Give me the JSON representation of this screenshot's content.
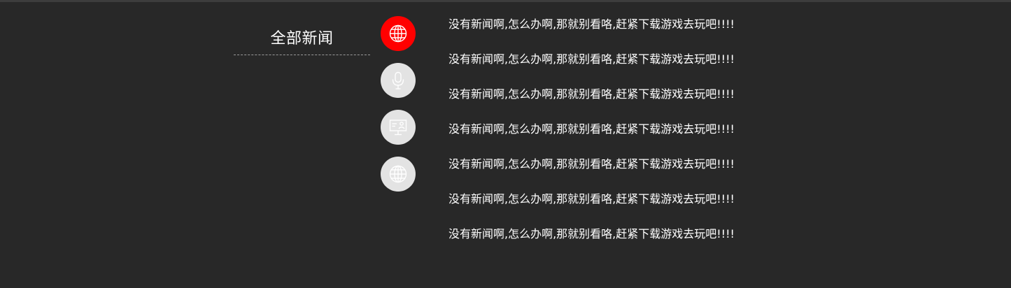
{
  "category": {
    "title": "全部新闻"
  },
  "category_icons": [
    {
      "name": "globe-icon",
      "active": true
    },
    {
      "name": "microphone-icon",
      "active": false
    },
    {
      "name": "presentation-icon",
      "active": false
    },
    {
      "name": "globe-icon",
      "active": false
    }
  ],
  "colors": {
    "background": "#282828",
    "active_icon_bg": "#ff0000",
    "inactive_icon_bg": "#e3e3e3",
    "text": "#ffffff"
  },
  "news": {
    "items": [
      {
        "text": "没有新闻啊,怎么办啊,那就别看咯,赶紧下载游戏去玩吧!!!!"
      },
      {
        "text": "没有新闻啊,怎么办啊,那就别看咯,赶紧下载游戏去玩吧!!!!"
      },
      {
        "text": "没有新闻啊,怎么办啊,那就别看咯,赶紧下载游戏去玩吧!!!!"
      },
      {
        "text": "没有新闻啊,怎么办啊,那就别看咯,赶紧下载游戏去玩吧!!!!"
      },
      {
        "text": "没有新闻啊,怎么办啊,那就别看咯,赶紧下载游戏去玩吧!!!!"
      },
      {
        "text": "没有新闻啊,怎么办啊,那就别看咯,赶紧下载游戏去玩吧!!!!"
      },
      {
        "text": "没有新闻啊,怎么办啊,那就别看咯,赶紧下载游戏去玩吧!!!!"
      }
    ]
  }
}
